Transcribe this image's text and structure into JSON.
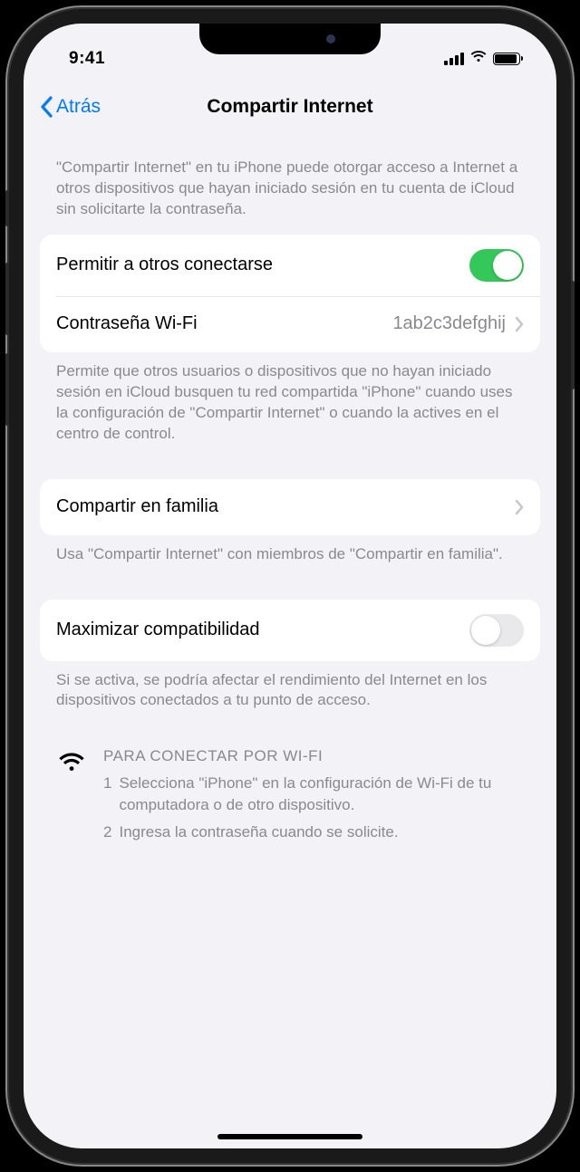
{
  "status": {
    "time": "9:41"
  },
  "nav": {
    "back_label": "Atrás",
    "title": "Compartir Internet"
  },
  "section1": {
    "header": "\"Compartir Internet\" en tu iPhone puede otorgar acceso a Internet a otros dispositivos que hayan iniciado sesión en tu cuenta de iCloud sin solicitarte la contraseña.",
    "rows": {
      "allow_others": {
        "label": "Permitir a otros conectarse",
        "enabled": true
      },
      "wifi_password": {
        "label": "Contraseña Wi-Fi",
        "value": "1ab2c3defghij"
      }
    },
    "footer": "Permite que otros usuarios o dispositivos que no hayan iniciado sesión en iCloud busquen tu red compartida \"iPhone\" cuando uses la configuración de \"Compartir Internet\" o cuando la actives en el centro de control."
  },
  "section2": {
    "rows": {
      "family_sharing": {
        "label": "Compartir en familia"
      }
    },
    "footer": "Usa \"Compartir Internet\" con miembros de \"Compartir en familia\"."
  },
  "section3": {
    "rows": {
      "maximize_compat": {
        "label": "Maximizar compatibilidad",
        "enabled": false
      }
    },
    "footer": "Si se activa, se podría afectar el rendimiento del Internet en los dispositivos conectados a tu punto de acceso."
  },
  "instructions": {
    "title": "PARA CONECTAR POR WI-FI",
    "steps": {
      "s1": {
        "num": "1",
        "text": "Selecciona \"iPhone\" en la configuración de Wi-Fi de tu computadora o de otro dispositivo."
      },
      "s2": {
        "num": "2",
        "text": "Ingresa la contraseña cuando se solicite."
      }
    }
  }
}
